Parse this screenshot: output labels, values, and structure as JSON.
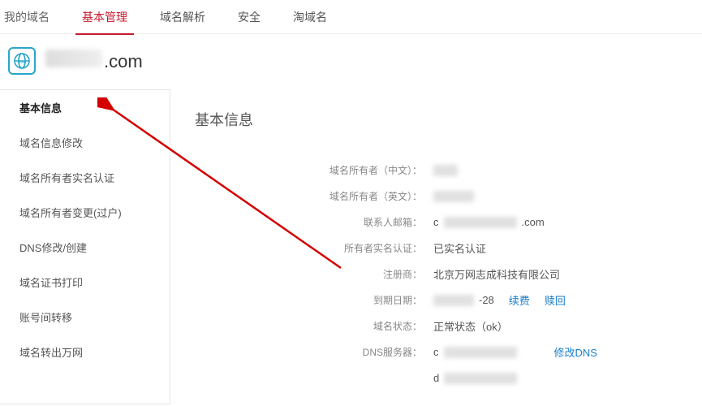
{
  "topnav": {
    "breadcrumb": "我的域名",
    "tabs": [
      {
        "label": "基本管理",
        "active": true
      },
      {
        "label": "域名解析",
        "active": false
      },
      {
        "label": "安全",
        "active": false
      },
      {
        "label": "淘域名",
        "active": false
      }
    ]
  },
  "header": {
    "domain_suffix": ".com"
  },
  "sidebar": {
    "items": [
      {
        "label": "基本信息",
        "active": true
      },
      {
        "label": "域名信息修改",
        "active": false
      },
      {
        "label": "域名所有者实名认证",
        "active": false
      },
      {
        "label": "域名所有者变更(过户)",
        "active": false
      },
      {
        "label": "DNS修改/创建",
        "active": false
      },
      {
        "label": "域名证书打印",
        "active": false
      },
      {
        "label": "账号间转移",
        "active": false
      },
      {
        "label": "域名转出万网",
        "active": false
      }
    ]
  },
  "main": {
    "title": "基本信息",
    "fields": {
      "owner_cn_label": "域名所有者（中文）：",
      "owner_en_label": "域名所有者（英文）：",
      "email_label": "联系人邮箱：",
      "email_value_prefix": "c",
      "email_value_suffix": ".com",
      "realname_label": "所有者实名认证：",
      "realname_value": "已实名认证",
      "registrar_label": "注册商：",
      "registrar_value": "北京万网志成科技有限公司",
      "expire_label": "到期日期：",
      "expire_fragment": "-28",
      "renew": "续费",
      "redeem": "赎回",
      "status_label": "域名状态：",
      "status_value": "正常状态（ok）",
      "dns_label": "DNS服务器：",
      "dns_value1_prefix": "c",
      "dns_value2_prefix": "d",
      "modify_dns": "修改DNS"
    }
  }
}
